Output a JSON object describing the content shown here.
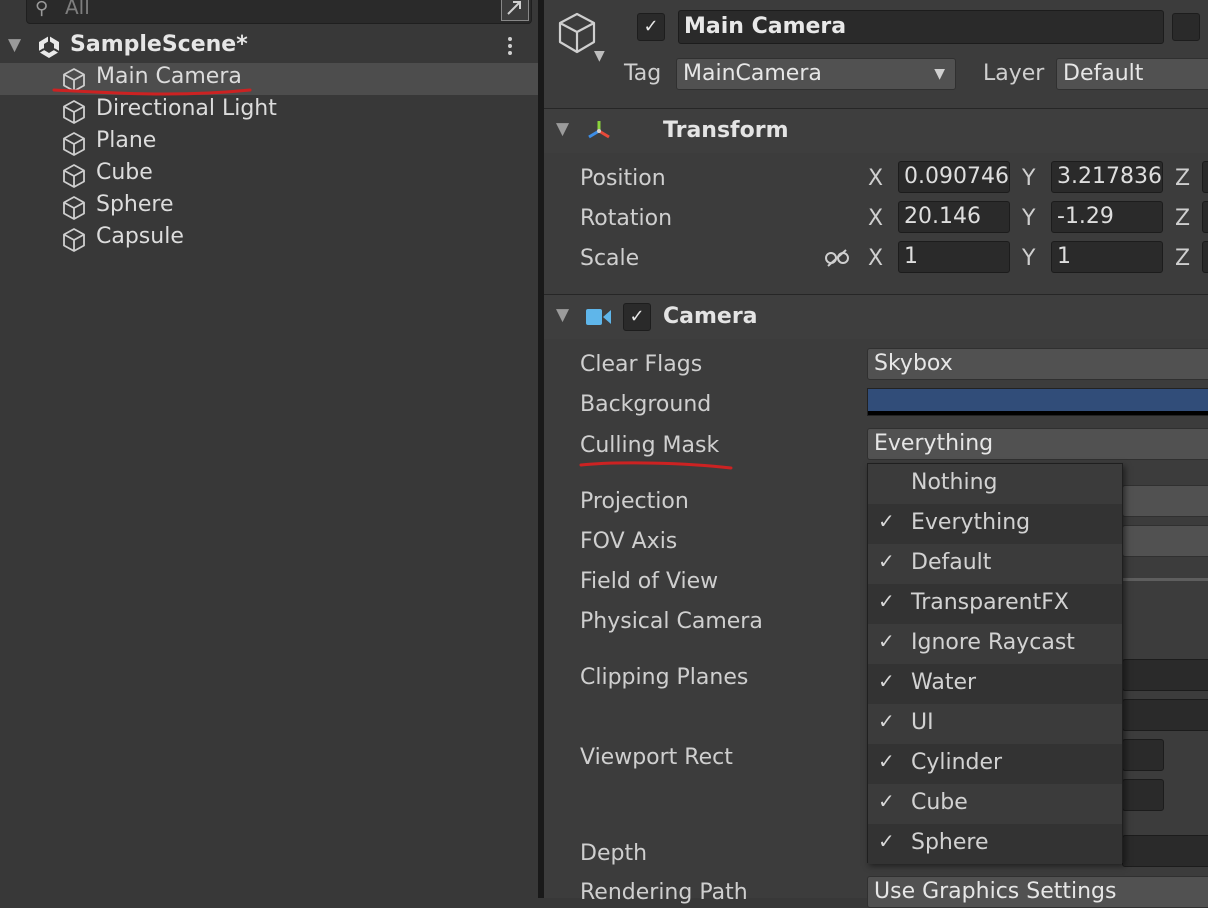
{
  "hierarchy": {
    "search_placeholder": "All",
    "scene_name": "SampleScene*",
    "items": [
      {
        "label": "Main Camera",
        "selected": true
      },
      {
        "label": "Directional Light",
        "selected": false
      },
      {
        "label": "Plane",
        "selected": false
      },
      {
        "label": "Cube",
        "selected": false
      },
      {
        "label": "Sphere",
        "selected": false
      },
      {
        "label": "Capsule",
        "selected": false
      }
    ]
  },
  "inspector": {
    "object_name": "Main Camera",
    "active_check": "✓",
    "tag_label": "Tag",
    "tag_value": "MainCamera",
    "layer_label": "Layer",
    "layer_value": "Default",
    "transform": {
      "title": "Transform",
      "position_label": "Position",
      "rotation_label": "Rotation",
      "scale_label": "Scale",
      "axis_x": "X",
      "axis_y": "Y",
      "axis_z": "Z",
      "position": {
        "x": "0.090746",
        "y": "3.217836"
      },
      "rotation": {
        "x": "20.146",
        "y": "-1.29"
      },
      "scale": {
        "x": "1",
        "y": "1"
      }
    },
    "camera": {
      "title": "Camera",
      "enabled_check": "✓",
      "clear_flags_label": "Clear Flags",
      "clear_flags_value": "Skybox",
      "background_label": "Background",
      "background_color": "#314d79",
      "culling_mask_label": "Culling Mask",
      "culling_mask_value": "Everything",
      "projection_label": "Projection",
      "fov_axis_label": "FOV Axis",
      "field_of_view_label": "Field of View",
      "physical_camera_label": "Physical Camera",
      "clipping_planes_label": "Clipping Planes",
      "viewport_rect_label": "Viewport Rect",
      "depth_label": "Depth",
      "rendering_path_label": "Rendering Path",
      "rendering_path_value": "Use Graphics Settings"
    }
  },
  "culling_mask_popup": {
    "options": [
      {
        "label": "Nothing",
        "checked": false,
        "check": ""
      },
      {
        "label": "Everything",
        "checked": true,
        "check": "✓"
      },
      {
        "label": "Default",
        "checked": true,
        "check": "✓"
      },
      {
        "label": "TransparentFX",
        "checked": true,
        "check": "✓"
      },
      {
        "label": "Ignore Raycast",
        "checked": true,
        "check": "✓"
      },
      {
        "label": "Water",
        "checked": true,
        "check": "✓"
      },
      {
        "label": "UI",
        "checked": true,
        "check": "✓"
      },
      {
        "label": "Cylinder",
        "checked": true,
        "check": "✓"
      },
      {
        "label": "Cube",
        "checked": true,
        "check": "✓"
      },
      {
        "label": "Sphere",
        "checked": true,
        "check": "✓"
      }
    ]
  },
  "annotations": {
    "underline_color": "#cc2222"
  }
}
